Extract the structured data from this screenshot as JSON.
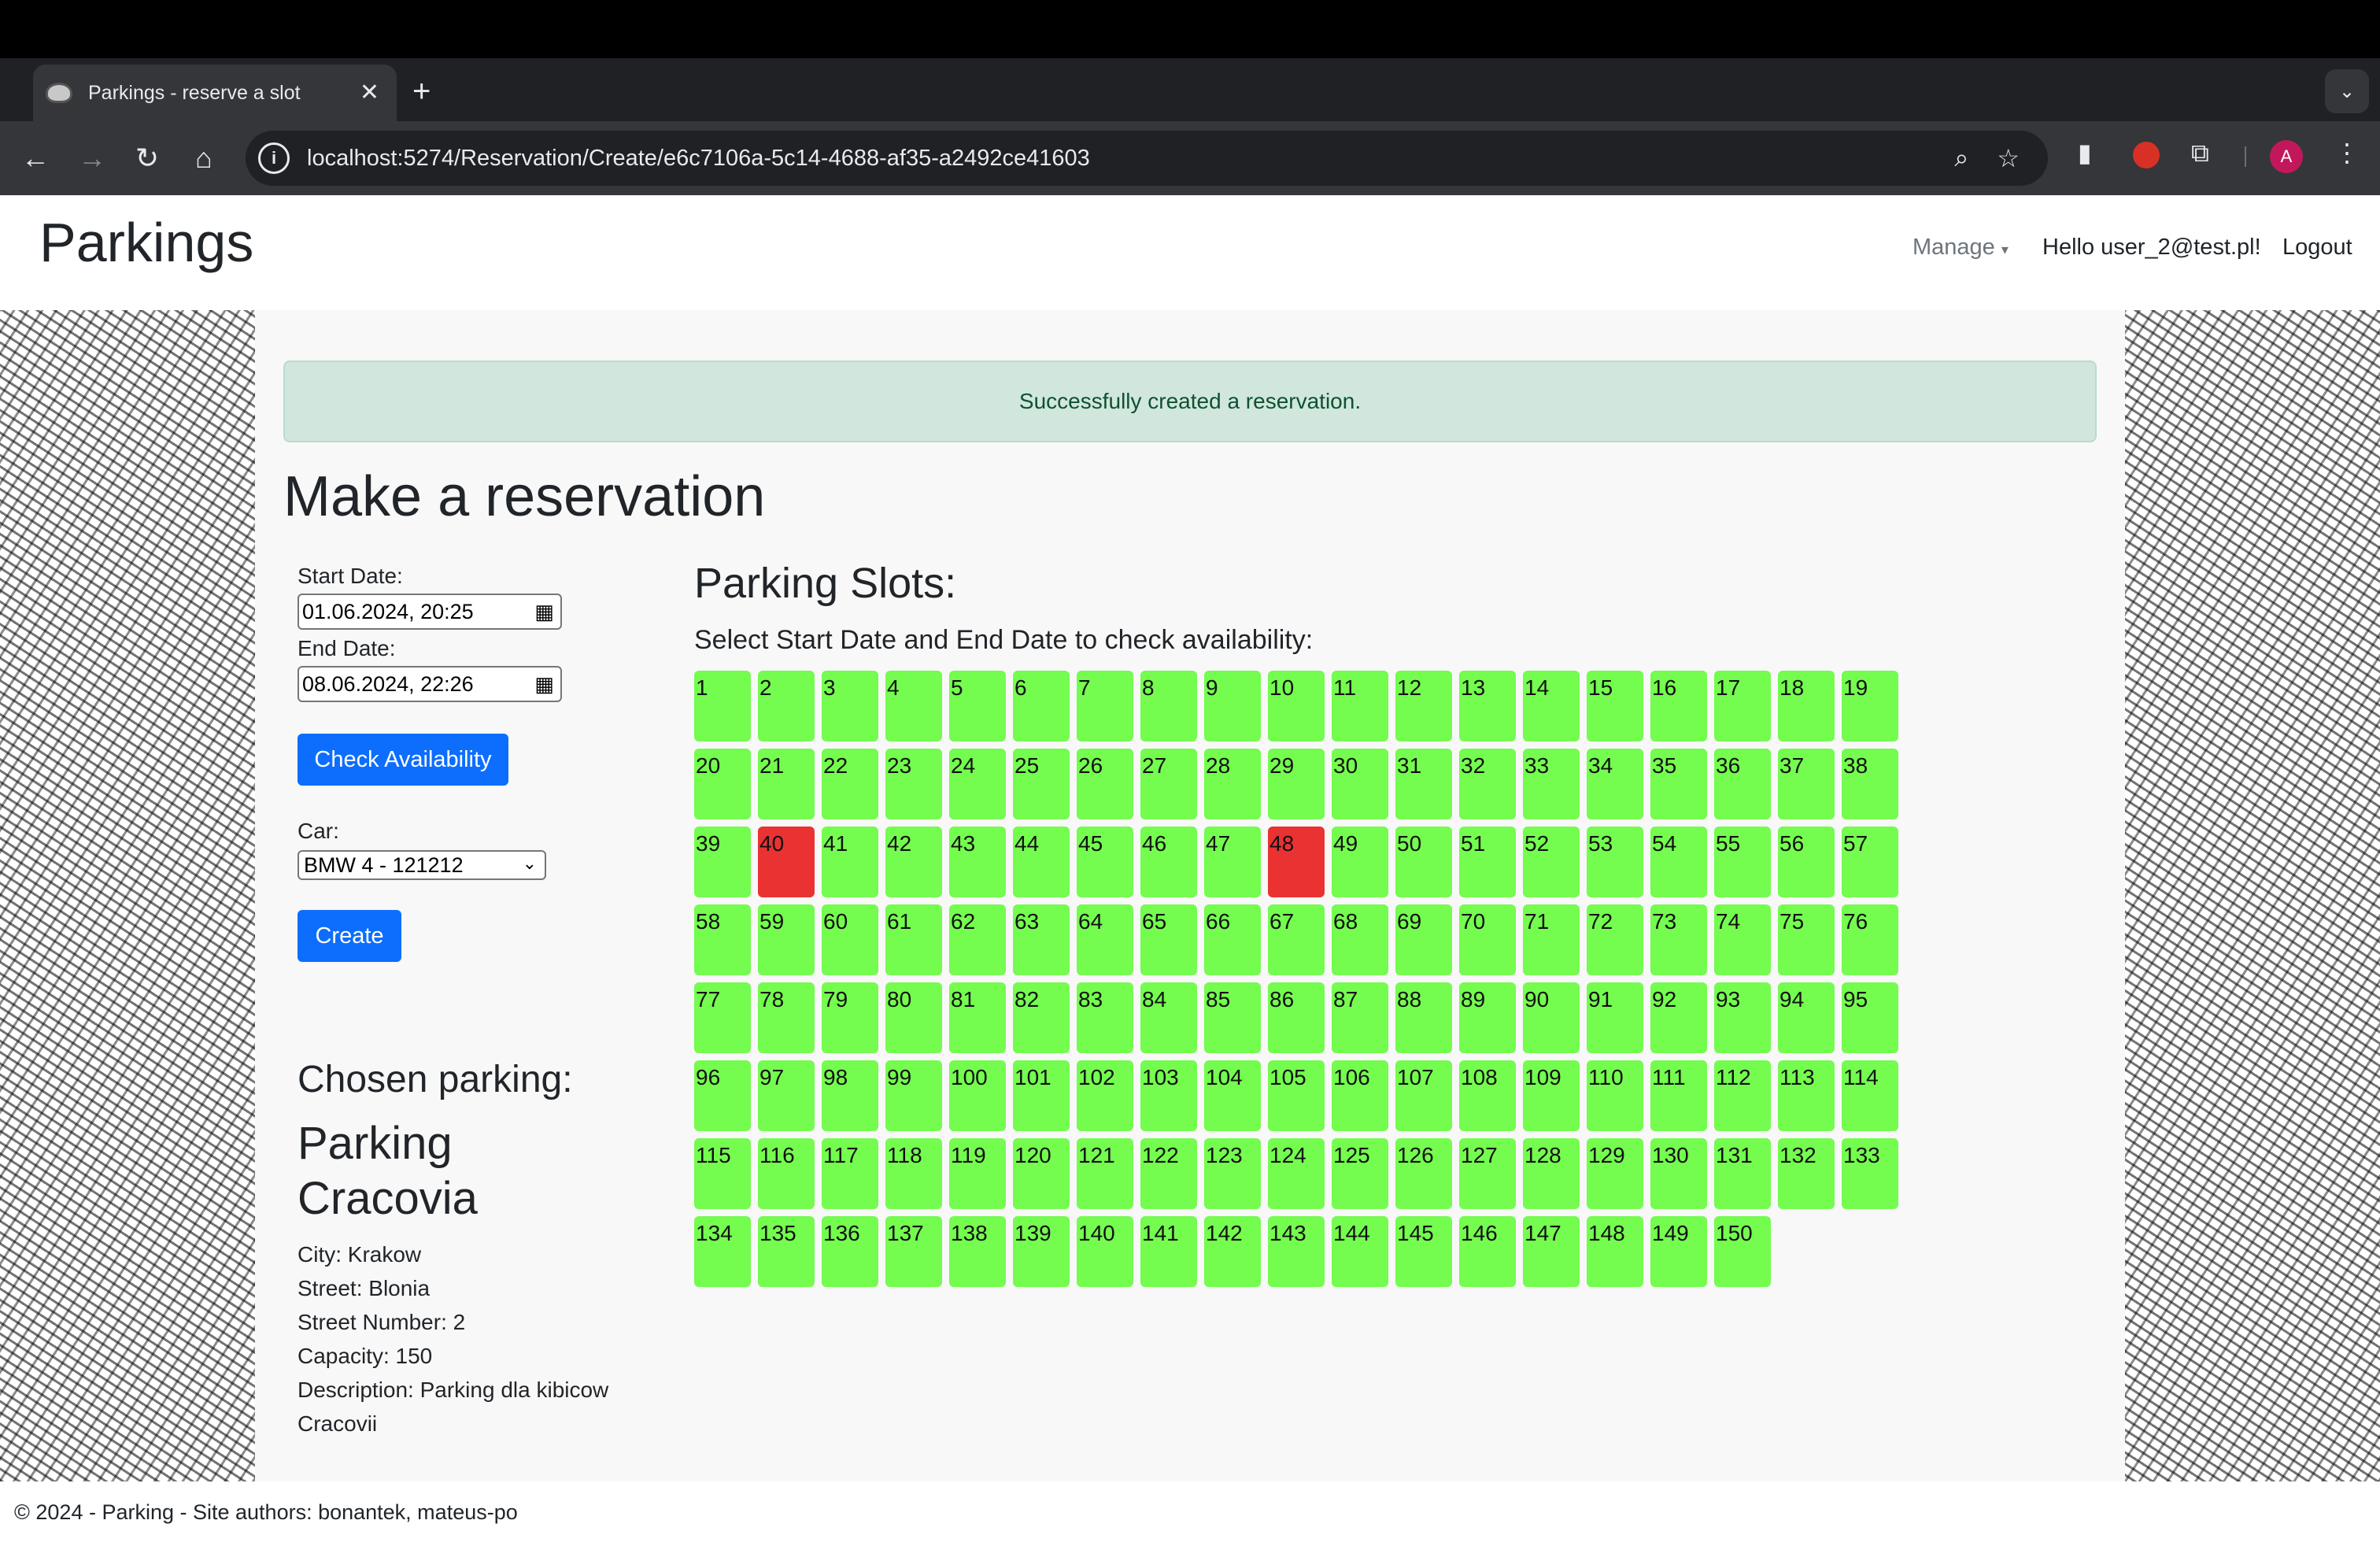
{
  "browser": {
    "tab_title": "Parkings - reserve a slot",
    "tab_close": "✕",
    "new_tab": "+",
    "url": "localhost:5274/Reservation/Create/e6c7106a-5c14-4688-af35-a2492ce41603",
    "avatar_letter": "A"
  },
  "header": {
    "brand": "Parkings",
    "manage": "Manage",
    "hello": "Hello user_2@test.pl!",
    "logout": "Logout"
  },
  "alert": {
    "message": "Successfully created a reservation."
  },
  "form": {
    "title": "Make a reservation",
    "start_label": "Start Date:",
    "start_value": "01.06.2024, 20:25",
    "end_label": "End Date:",
    "end_value": "08.06.2024, 22:26",
    "check_button": "Check Availability",
    "car_label": "Car:",
    "car_value": "BMW 4 - 121212",
    "create_button": "Create"
  },
  "parking": {
    "chosen_title": "Chosen parking:",
    "name": "Parking Cracovia",
    "city": "City: Krakow",
    "street": "Street: Blonia",
    "street_number": "Street Number: 2",
    "capacity": "Capacity: 150",
    "description": "Description: Parking dla kibicow Cracovii"
  },
  "slots": {
    "title": "Parking Slots:",
    "subtitle": "Select Start Date and End Date to check availability:",
    "total": 150,
    "per_row": 19,
    "taken": [
      40,
      48
    ],
    "colors": {
      "free": "#74fc4f",
      "taken": "#ea3232"
    }
  },
  "footer": {
    "text": "© 2024 - Parking - Site authors: bonantek, mateus-po"
  },
  "colors": {
    "primary": "#0d6efd",
    "alert_bg": "#d1e7dd",
    "alert_text": "#0f5132"
  }
}
